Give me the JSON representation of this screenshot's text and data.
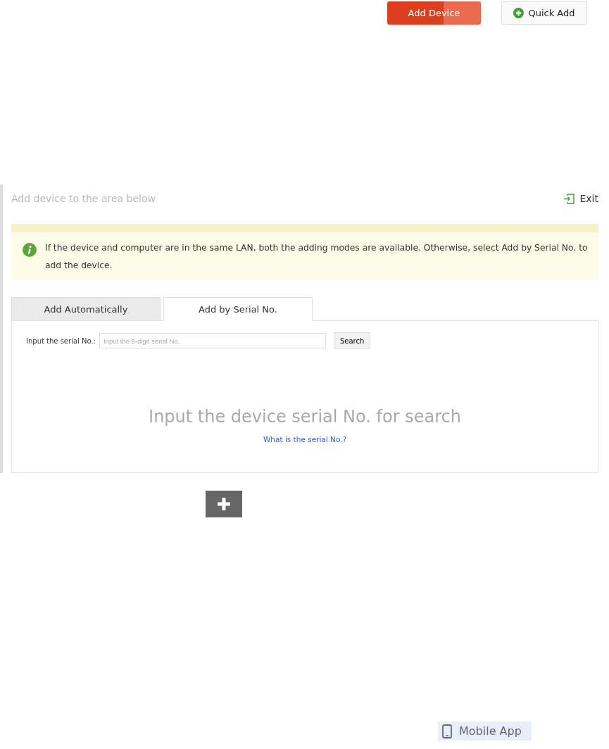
{
  "top_buttons": [
    {
      "kind": "primary",
      "label": "Add Device"
    },
    {
      "kind": "add",
      "label": "Quick Add"
    }
  ],
  "panel": {
    "title": "Add device to the area below",
    "exit": "Exit",
    "notice": "If the device and computer are in the same LAN, both the adding modes are available. Otherwise, select Add by Serial No. to add the device.",
    "tabs": [
      {
        "label": "Add Automatically",
        "selected": false
      },
      {
        "label": "Add by Serial No.",
        "selected": true
      }
    ],
    "serial_label": "Input the serial No.:",
    "serial_placeholder": "Input the 9-digit serial No.",
    "search": "Search",
    "empty_text": "Input the device serial No. for search",
    "help_link": "What is the serial No.?"
  },
  "mobile_app": "Mobile App"
}
